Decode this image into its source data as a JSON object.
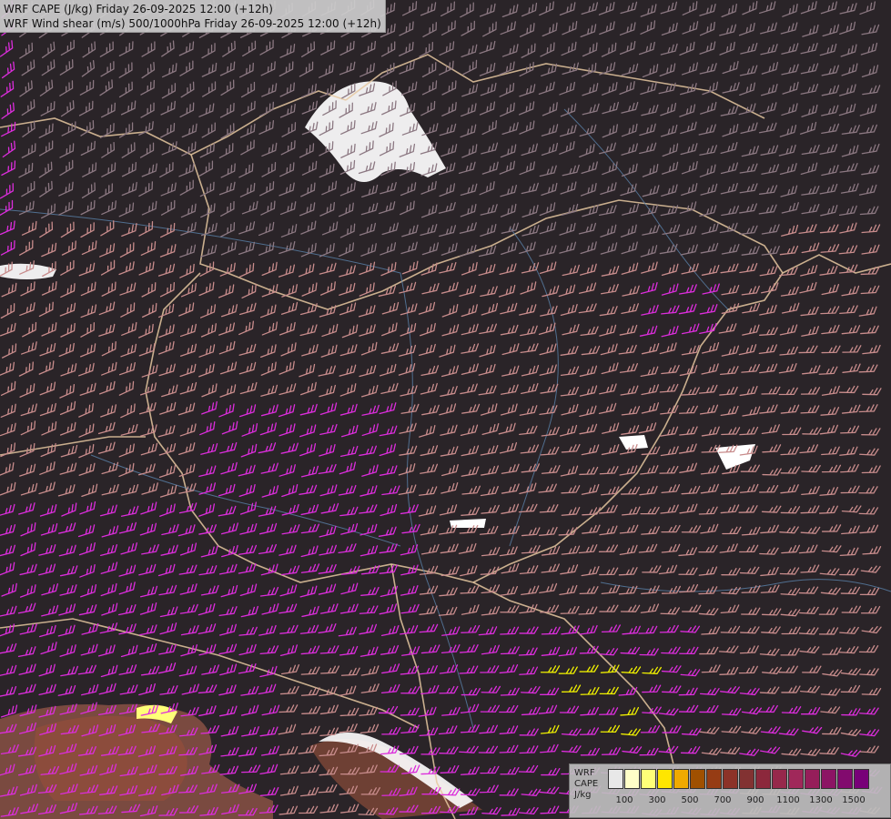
{
  "titles": {
    "line1": "WRF CAPE (J/kg) Friday 26-09-2025 12:00 (+12h)",
    "line2": "WRF Wind shear (m/s) 500/1000hPa Friday 26-09-2025 12:00 (+12h)"
  },
  "legend": {
    "label_model": "WRF",
    "label_field": "CAPE",
    "label_unit": "J/kg",
    "swatches": [
      "#e8e8e8",
      "#ffffc8",
      "#ffff78",
      "#ffe600",
      "#f0aa00",
      "#a05000",
      "#963c14",
      "#8c3228",
      "#823232",
      "#8c283c",
      "#96284b",
      "#a0285a",
      "#961e5a",
      "#8c1464",
      "#820a6e",
      "#780078"
    ],
    "ticks": [
      "100",
      "300",
      "500",
      "700",
      "900",
      "1100",
      "1300",
      "1500"
    ]
  },
  "colors": {
    "background": "#2a2428",
    "barb_normal": "#c88c8c",
    "barb_dim": "#8c7882",
    "barb_strong": "#dc2ddc",
    "barb_strongest": "#f0f000",
    "border_line": "#e6c8a0",
    "river_line": "#5a82aa",
    "cape_high": "#965046",
    "cape_low": "#ffffff"
  },
  "map": {
    "field_shaded": "CAPE",
    "overlay": "wind shear barbs",
    "region": "Hungary and surrounding Carpathian basin"
  }
}
